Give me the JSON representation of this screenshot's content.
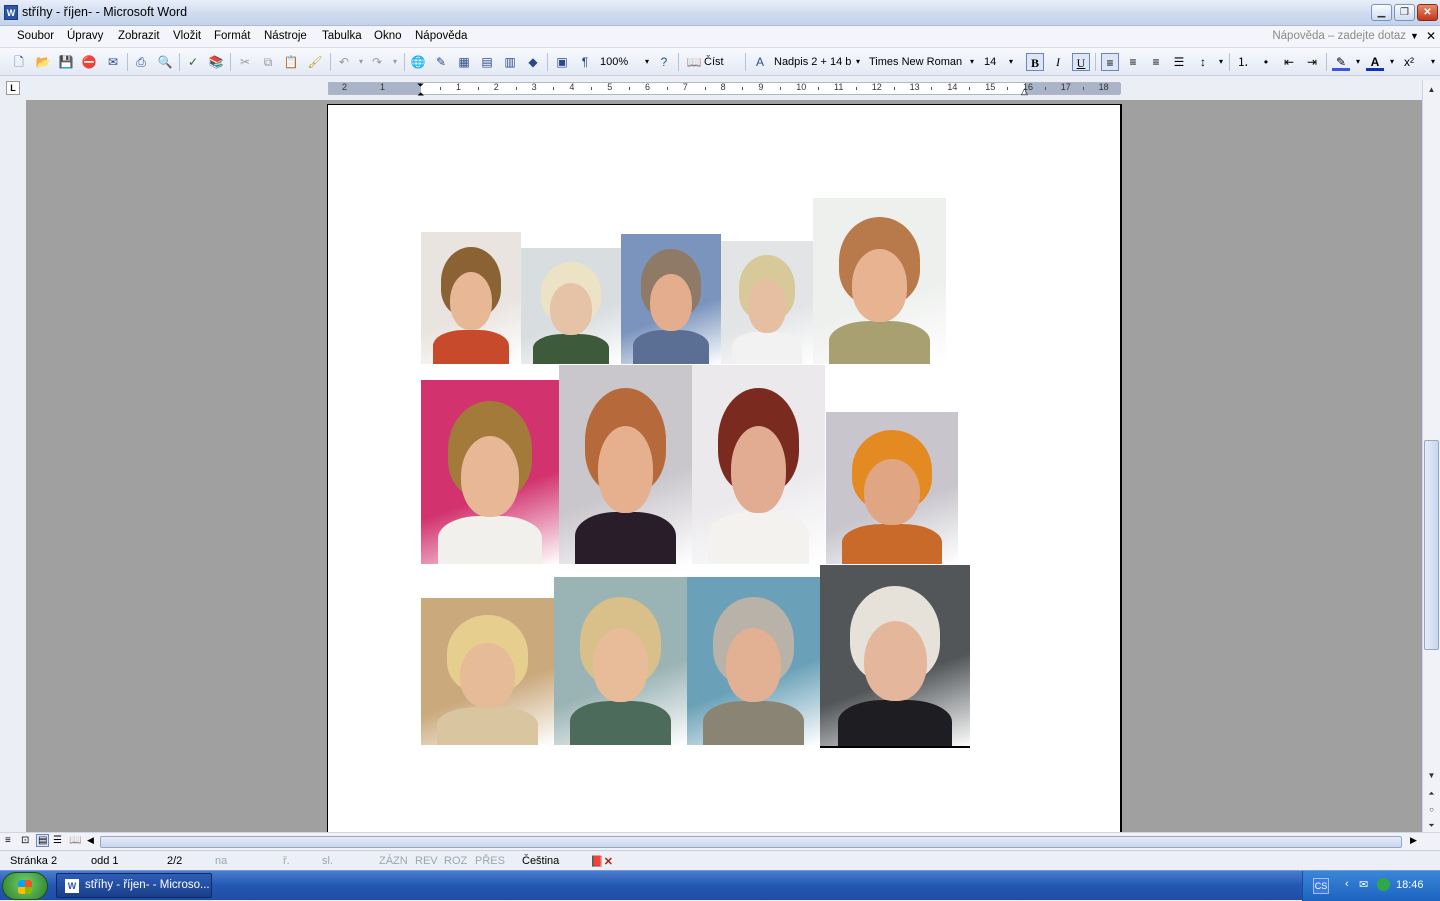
{
  "window": {
    "title": "stříhy - říjen- - Microsoft Word",
    "app_icon": "word-document-icon"
  },
  "menu": {
    "items": [
      {
        "label": "Soubor"
      },
      {
        "label": "Úpravy"
      },
      {
        "label": "Zobrazit"
      },
      {
        "label": "Vložit"
      },
      {
        "label": "Formát"
      },
      {
        "label": "Nástroje"
      },
      {
        "label": "Tabulka"
      },
      {
        "label": "Okno"
      },
      {
        "label": "Nápověda"
      }
    ],
    "help_placeholder": "Nápověda – zadejte dotaz"
  },
  "toolbar": {
    "zoom": "100%",
    "read_label": "Číst",
    "style": "Nadpis 2 + 14 b",
    "font": "Times New Roman",
    "size": "14",
    "bold": "B",
    "italic": "I",
    "underline": "U",
    "pilcrow": "¶",
    "x2": "x²"
  },
  "ruler": {
    "left_numbers": [
      "2",
      "1"
    ],
    "right_numbers": [
      "1",
      "2",
      "3",
      "4",
      "5",
      "6",
      "7",
      "8",
      "9",
      "10",
      "11",
      "12",
      "13",
      "14",
      "15",
      "16",
      "17",
      "18"
    ],
    "tab_stop": "L"
  },
  "document": {
    "photos_row1": 5,
    "photos_row2": 4,
    "photos_row3": 4
  },
  "statusbar": {
    "page": "Stránka 2",
    "section": "odd 1",
    "pages": "2/2",
    "at": "na",
    "line": "ř.",
    "col": "sl.",
    "rec": "ZÁZN",
    "rev": "REV",
    "ext": "ROZ",
    "ovr": "PŘES",
    "language": "Čeština"
  },
  "taskbar": {
    "task_label": "stříhy - říjen- - Microso...",
    "lang": "CS",
    "clock": "18:46"
  },
  "colors": {
    "titlebar": "#cfdcf0",
    "canvas": "#a0a0a0",
    "taskbar": "#2457b3"
  }
}
